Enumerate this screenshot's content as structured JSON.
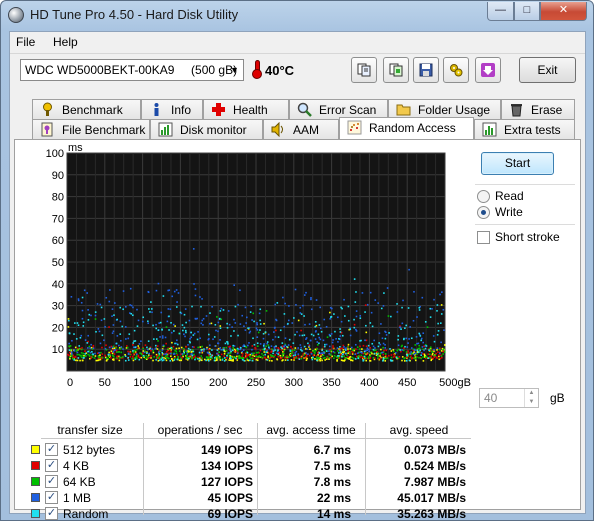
{
  "window": {
    "title": "HD Tune Pro 4.50 - Hard Disk Utility"
  },
  "menu": [
    {
      "label": "File"
    },
    {
      "label": "Help"
    }
  ],
  "toolbar": {
    "drive": "WDC WD5000BEKT-00KA9     (500 gB)",
    "temperature": "40°C",
    "exit_label": "Exit",
    "buttons": [
      "copy-info-icon",
      "copy-screen-icon",
      "save-icon",
      "options-icon",
      "download-icon"
    ]
  },
  "tabs_row1": [
    {
      "label": "Benchmark",
      "icon": "benchmark-icon"
    },
    {
      "label": "Info",
      "icon": "info-icon"
    },
    {
      "label": "Health",
      "icon": "health-icon"
    },
    {
      "label": "Error Scan",
      "icon": "error-scan-icon"
    },
    {
      "label": "Folder Usage",
      "icon": "folder-icon"
    },
    {
      "label": "Erase",
      "icon": "erase-icon"
    }
  ],
  "tabs_row2": [
    {
      "label": "File Benchmark",
      "icon": "file-benchmark-icon"
    },
    {
      "label": "Disk monitor",
      "icon": "disk-monitor-icon"
    },
    {
      "label": "AAM",
      "icon": "aam-icon"
    },
    {
      "label": "Random Access",
      "icon": "random-access-icon",
      "active": true
    },
    {
      "label": "Extra tests",
      "icon": "extra-tests-icon"
    }
  ],
  "options": {
    "start_label": "Start",
    "read_label": "Read",
    "write_label": "Write",
    "selected_mode": "Write",
    "short_stroke_label": "Short stroke",
    "short_stroke_checked": false,
    "short_stroke_value": "40",
    "short_stroke_unit": "gB"
  },
  "results": {
    "headers": [
      "transfer size",
      "operations / sec",
      "avg. access time",
      "avg. speed"
    ],
    "rows": [
      {
        "size": "512 bytes",
        "color": "#ffff00",
        "iops": "149 IOPS",
        "access": "6.7 ms",
        "speed": "0.073 MB/s"
      },
      {
        "size": "4 KB",
        "color": "#e00000",
        "iops": "134 IOPS",
        "access": "7.5 ms",
        "speed": "0.524 MB/s"
      },
      {
        "size": "64 KB",
        "color": "#00c000",
        "iops": "127 IOPS",
        "access": "7.8 ms",
        "speed": "7.987 MB/s"
      },
      {
        "size": "1 MB",
        "color": "#2060e0",
        "iops": "45 IOPS",
        "access": "22 ms",
        "speed": "45.017 MB/s"
      },
      {
        "size": "Random",
        "color": "#20e0f0",
        "iops": "69 IOPS",
        "access": "14 ms",
        "speed": "35.263 MB/s"
      }
    ]
  },
  "chart_data": {
    "type": "scatter",
    "ylabel": "ms",
    "xlabel_suffix": "gB",
    "xlim": [
      0,
      500
    ],
    "ylim": [
      0,
      100
    ],
    "xticks": [
      "0",
      "50",
      "100",
      "150",
      "200",
      "250",
      "300",
      "350",
      "400",
      "450",
      "500gB"
    ],
    "yticks": [
      "10",
      "20",
      "30",
      "40",
      "50",
      "60",
      "70",
      "80",
      "90",
      "100"
    ],
    "grid": true,
    "series": [
      {
        "name": "512 bytes",
        "color": "#ffff00",
        "typical_ms": [
          5,
          12
        ]
      },
      {
        "name": "4 KB",
        "color": "#e00000",
        "typical_ms": [
          6,
          12
        ]
      },
      {
        "name": "64 KB",
        "color": "#00c000",
        "typical_ms": [
          6,
          12
        ]
      },
      {
        "name": "1 MB",
        "color": "#2060e0",
        "typical_ms": [
          8,
          38
        ]
      },
      {
        "name": "Random",
        "color": "#20e0f0",
        "typical_ms": [
          5,
          30
        ]
      }
    ]
  }
}
